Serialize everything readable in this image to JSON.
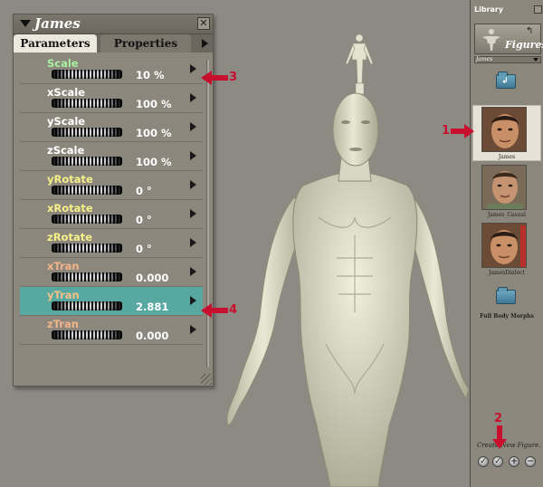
{
  "param_panel": {
    "title": "James",
    "tabs": [
      "Parameters",
      "Properties"
    ],
    "parameters": [
      {
        "name": "Scale",
        "value": "10 %",
        "name_color": "#a8f0a0"
      },
      {
        "name": "xScale",
        "value": "100 %",
        "name_color": "#ffffff"
      },
      {
        "name": "yScale",
        "value": "100 %",
        "name_color": "#ffffff"
      },
      {
        "name": "zScale",
        "value": "100 %",
        "name_color": "#ffffff"
      },
      {
        "name": "yRotate",
        "value": "0 °",
        "name_color": "#f6f08a"
      },
      {
        "name": "xRotate",
        "value": "0 °",
        "name_color": "#f6f08a"
      },
      {
        "name": "zRotate",
        "value": "0 °",
        "name_color": "#f6f08a"
      },
      {
        "name": "xTran",
        "value": "0.000",
        "name_color": "#f3b48a"
      },
      {
        "name": "yTran",
        "value": "2.881",
        "name_color": "#f6c08a"
      },
      {
        "name": "zTran",
        "value": "0.000",
        "name_color": "#f3b48a"
      }
    ],
    "selected_parameter": "yTran"
  },
  "library": {
    "title": "Library",
    "category": "Figures",
    "current_path": "James",
    "items": [
      {
        "type": "folder-up",
        "label": ""
      },
      {
        "type": "figure",
        "label": "James"
      },
      {
        "type": "figure",
        "label": "James_Casual"
      },
      {
        "type": "figure",
        "label": "JamesDialect"
      },
      {
        "type": "folder",
        "label": "Full Body Morphs"
      }
    ],
    "status": "Create New Figure."
  },
  "callouts": [
    "1",
    "2",
    "3",
    "4"
  ],
  "colors": {
    "panel": "#8b877c",
    "selected_row": "#56a8a0",
    "callout_red": "#c8102e"
  }
}
